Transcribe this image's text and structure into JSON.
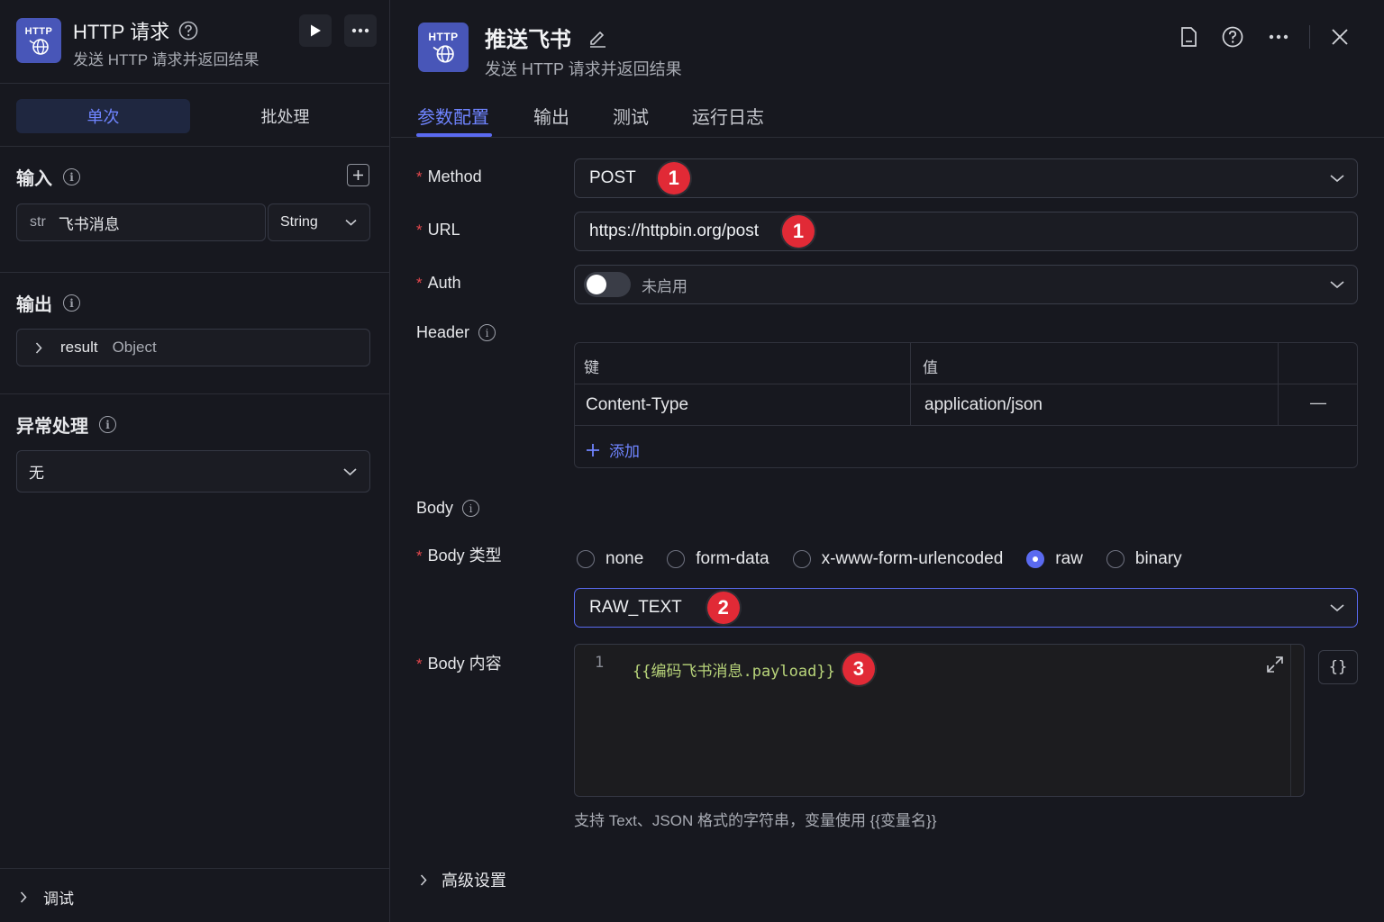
{
  "node": {
    "logo_text": "HTTP",
    "title": "HTTP 请求",
    "subtitle": "发送 HTTP 请求并返回结果"
  },
  "left": {
    "mode_tabs": [
      "单次",
      "批处理"
    ],
    "input_section": "输入",
    "input_row": {
      "type_prefix": "str",
      "value": "飞书消息",
      "type_select": "String"
    },
    "output_section": "输出",
    "output_row": {
      "name": "result",
      "type": "Object"
    },
    "error_section": "异常处理",
    "error_select": "无",
    "debug_label": "调试"
  },
  "panel": {
    "logo_text": "HTTP",
    "title": "推送飞书",
    "subtitle": "发送 HTTP 请求并返回结果",
    "tabs": [
      "参数配置",
      "输出",
      "测试",
      "运行日志"
    ]
  },
  "form": {
    "method_label": "Method",
    "method_value": "POST",
    "url_label": "URL",
    "url_value": "https://httpbin.org/post",
    "auth_label": "Auth",
    "auth_value": "未启用",
    "header_label": "Header",
    "header_table": {
      "col_key": "键",
      "col_value": "值",
      "rows": [
        {
          "key": "Content-Type",
          "value": "application/json"
        }
      ],
      "add_label": "添加",
      "remove_symbol": "—"
    },
    "body_label": "Body",
    "body_type_label": "Body 类型",
    "body_types": [
      "none",
      "form-data",
      "x-www-form-urlencoded",
      "raw",
      "binary"
    ],
    "body_type_selected": "raw",
    "raw_format": "RAW_TEXT",
    "body_content_label": "Body 内容",
    "code_line_number": "1",
    "code_text": "{{编码飞书消息.payload}}",
    "code_hint": "支持 Text、JSON 格式的字符串，变量使用 {{变量名}}",
    "json_button": "{}",
    "advanced_label": "高级设置"
  },
  "badges": {
    "method": "1",
    "url": "1",
    "raw": "2",
    "code": "3"
  },
  "colors": {
    "accent": "#5a6af0",
    "badge": "#e12a36",
    "logo": "#4856b8",
    "code": "#b8d47a"
  }
}
